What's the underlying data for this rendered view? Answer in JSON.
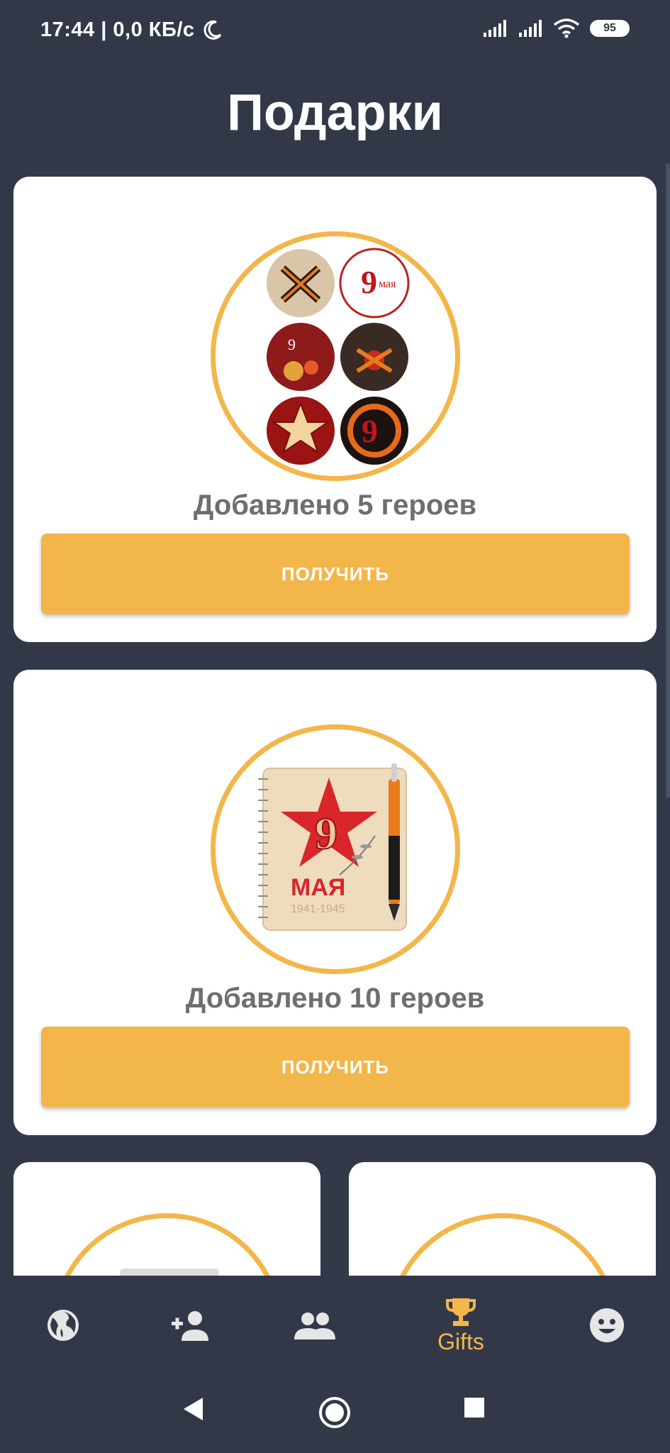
{
  "status_bar": {
    "time": "17:44 | 0,0 КБ/с",
    "battery": "95"
  },
  "header": {
    "title": "Подарки"
  },
  "gifts": [
    {
      "caption": "Добавлено 5 героев",
      "button": "ПОЛУЧИТЬ",
      "image": "may-9-badges-set"
    },
    {
      "caption": "Добавлено 10 героев",
      "button": "ПОЛУЧИТЬ",
      "image": "may-9-notebook",
      "image_text": {
        "day": "9",
        "month": "МАЯ",
        "years": "1941-1945"
      }
    }
  ],
  "bottom_nav": {
    "items": [
      {
        "icon": "globe-icon",
        "label": ""
      },
      {
        "icon": "add-person-icon",
        "label": ""
      },
      {
        "icon": "people-icon",
        "label": ""
      },
      {
        "icon": "trophy-icon",
        "label": "Gifts",
        "active": true
      },
      {
        "icon": "smiley-icon",
        "label": ""
      }
    ]
  },
  "colors": {
    "background": "#333849",
    "accent": "#F3B64A",
    "card": "#FFFFFF",
    "caption": "#6E6E6E"
  }
}
